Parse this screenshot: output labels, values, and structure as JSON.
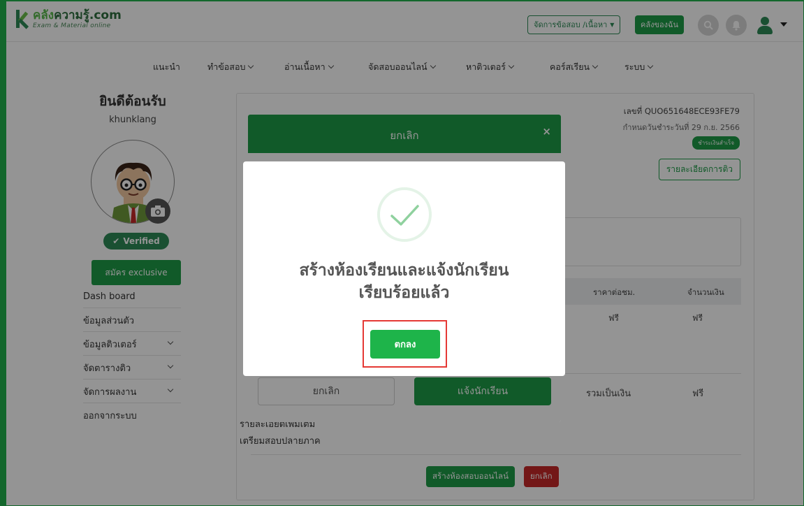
{
  "header": {
    "logo_main_a": "คลัง",
    "logo_main_b": "ความรู้.com",
    "logo_sub": "Exam & Material online",
    "manage_label": "จัดการข้อสอบ /เนื้อหา",
    "my_library_label": "คลังของฉัน",
    "icons": [
      "search-icon",
      "bell-icon",
      "user-icon"
    ]
  },
  "nav": {
    "items": [
      {
        "label": "แนะนำ",
        "dropdown": false
      },
      {
        "label": "ทำข้อสอบ",
        "dropdown": true
      },
      {
        "label": "อ่านเนื้อหา",
        "dropdown": true
      },
      {
        "label": "จัดสอบออนไลน์",
        "dropdown": true
      },
      {
        "label": "หาติวเตอร์",
        "dropdown": true
      },
      {
        "label": "คอร์สเรียน",
        "dropdown": true
      },
      {
        "label": "ระบบ",
        "dropdown": true
      }
    ]
  },
  "sidebar": {
    "welcome": "ยินดีต้อนรับ",
    "username": "khunklang",
    "verified_label": "Verified",
    "exclusive_label": "สมัคร exclusive",
    "menu": [
      {
        "label": "Dash board",
        "dropdown": false
      },
      {
        "label": "ข้อมูลส่วนตัว",
        "dropdown": false
      },
      {
        "label": "ข้อมูลติวเตอร์",
        "dropdown": true
      },
      {
        "label": "จัดตารางติว",
        "dropdown": true
      },
      {
        "label": "จัดการผลงาน",
        "dropdown": true
      },
      {
        "label": "ออกจากระบบ",
        "dropdown": false
      }
    ]
  },
  "quote": {
    "number": "เลขที่ QUO651648ECE93FE79",
    "due": "กำหนดวันชำระวันที่ 29 ก.ย. 2566",
    "status_badge": "ชำระเงินสำเร็จ",
    "detail_button": "รายละเอียดการติว",
    "table": {
      "headers": [
        "ราคาต่อชม.",
        "จำนวนเงิน"
      ],
      "rows": [
        [
          "ฟรี",
          "ฟรี"
        ]
      ]
    },
    "total_label": "รวมเป็นเงิน",
    "total_value": "ฟรี",
    "notes": [
      "รายละเอียดเพิ่มเติม",
      "เตรียมสอบปลายภาค"
    ],
    "create_room_button": "สร้างห้องสอบออนไลน์",
    "cancel_button": "ยกเลิก"
  },
  "modal": {
    "title": "ยกเลิก",
    "close": "×",
    "cancel_button": "ยกเลิก",
    "notify_button": "แจ้งนักเรียน"
  },
  "success_dialog": {
    "line1": "สร้างห้องเรียนและแจ้งนักเรียน",
    "line2": "เรียบร้อยแล้ว",
    "ok_button": "ตกลง",
    "check_color": "#8fd19e",
    "highlight_color": "#e53935"
  },
  "colors": {
    "brand_green": "#1e9b47",
    "danger_red": "#c62828"
  }
}
